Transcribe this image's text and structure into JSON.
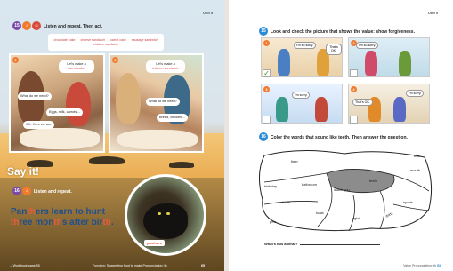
{
  "left_page": {
    "unit_label": "Unit 5",
    "activity_number": "15",
    "activity_instruction": "Listen and repeat. Then act.",
    "word_box": [
      "chocolate cake",
      "cheese sandwich",
      "carrot cake",
      "sausage sandwich",
      "chicken sandwich"
    ],
    "photo1": {
      "number": "1",
      "bubbles": [
        {
          "text": "Let's make a",
          "highlight": "carrot cake."
        },
        {
          "text": "What do we need?",
          "highlight": ""
        },
        {
          "text": "Eggs, milk, carrots ...",
          "highlight": ""
        },
        {
          "text": "OK. Here we are.",
          "highlight": ""
        }
      ]
    },
    "photo2": {
      "number": "2",
      "bubbles": [
        {
          "text": "Let's make a",
          "highlight": "chicken sandwich."
        },
        {
          "text": "What do we need?",
          "highlight": ""
        },
        {
          "text": "Bread, chicken ...",
          "highlight": ""
        }
      ]
    },
    "say_it_title": "Say it!",
    "phonics_number": "16",
    "phonics_instruction": "Listen and repeat.",
    "phonics_sentence": [
      {
        "t": "Pan",
        "hl": false
      },
      {
        "t": "th",
        "hl": true
      },
      {
        "t": "ers learn to hunt ",
        "hl": false
      },
      {
        "t": "th",
        "hl": true
      },
      {
        "t": "ree mon",
        "hl": false
      },
      {
        "t": "th",
        "hl": true
      },
      {
        "t": "s after bir",
        "hl": false
      },
      {
        "t": "th",
        "hl": true
      },
      {
        "t": ".",
        "hl": false
      }
    ],
    "panther_label": "panthers",
    "footer_left": "→ Workbook page 55",
    "footer_center": "Function: Suggesting food to make   Pronunciation: th",
    "page_number": "65"
  },
  "right_page": {
    "unit_label": "Unit 5",
    "activity15_number": "15",
    "activity15_instruction": "Look and check the picture that shows the value: show forgiveness.",
    "pictures": [
      {
        "number": "1",
        "bubbles": [
          "I'm so sorry.",
          "That's OK."
        ],
        "checked": true
      },
      {
        "number": "2",
        "bubbles": [
          "I'm so sorry."
        ],
        "checked": false
      },
      {
        "number": "3",
        "bubbles": [
          "I'm sorry."
        ],
        "checked": false
      },
      {
        "number": "4",
        "bubbles": [
          "That's OK.",
          "I'm sorry."
        ],
        "checked": false
      }
    ],
    "check_mark": "✓",
    "activity16_number": "16",
    "activity16_instruction": "Color the words that sound like teeth. Then answer the question.",
    "map_words": [
      "tiger",
      "bee",
      "mouth",
      "birthday",
      "bathroom",
      "teeth",
      "thank you",
      "turtle",
      "toast",
      "night",
      "sports",
      "pets",
      "thirty"
    ],
    "question": "What's this animal?",
    "footer_text": "Value   Pronunciation: th",
    "page_number": "53"
  },
  "colors": {
    "phonics_highlight": "#e85b3a",
    "phonics_text": "#1f4f8f",
    "badge_orange": "#f07b2e",
    "badge_blue": "#2a8bd6",
    "word_highlight": "#d9534f"
  }
}
